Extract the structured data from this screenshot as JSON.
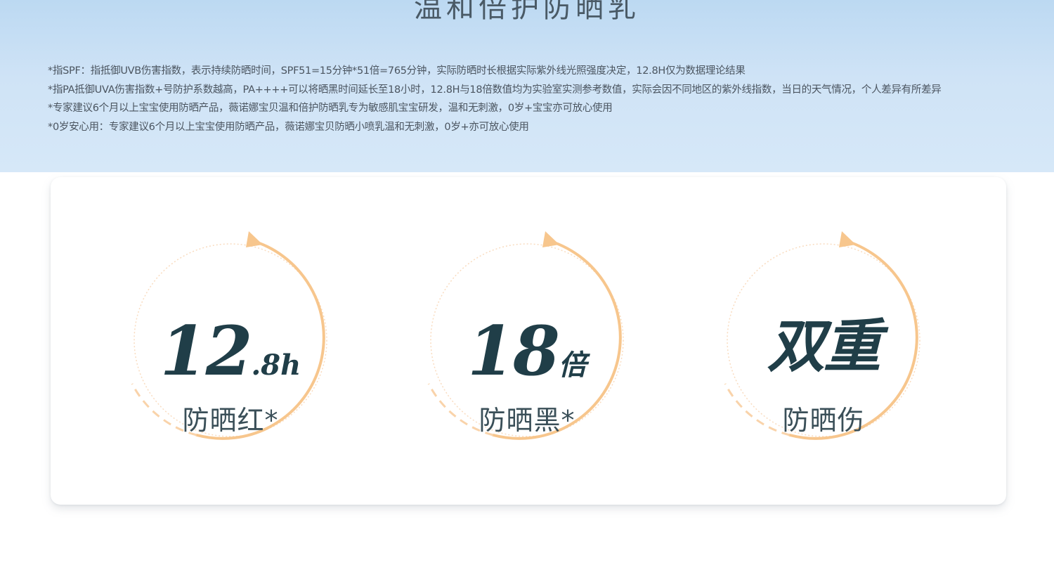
{
  "banner": {
    "title": "温和倍护防晒乳",
    "footnotes": [
      "*指SPF：指抵御UVB伤害指数，表示持续防晒时间，SPF51=15分钟*51倍=765分钟，实际防晒时长根据实际紫外线光照强度决定，12.8H仅为数据理论结果",
      "*指PA抵御UVA伤害指数+号防护系数越高，PA++++可以将晒黑时间延长至18小时，12.8H与18倍数值均为实验室实测参考数值，实际会因不同地区的紫外线指数，当日的天气情况，个人差异有所差异",
      "*专家建议6个月以上宝宝使用防晒产品，薇诺娜宝贝温和倍护防晒乳专为敏感肌宝宝研发，温和无刺激，0岁+宝宝亦可放心使用",
      "*0岁安心用：专家建议6个月以上宝宝使用防晒产品，薇诺娜宝贝防晒小喷乳温和无刺激，0岁+亦可放心使用"
    ]
  },
  "stats": [
    {
      "value_main": "12",
      "value_suffix": ".8h",
      "label": "防晒红*"
    },
    {
      "value_main": "18",
      "value_suffix": "倍",
      "label": "防晒黑*"
    },
    {
      "value_main": "双重",
      "value_suffix": "",
      "label": "防晒伤"
    }
  ],
  "colors": {
    "banner_top": "#bcd9f2",
    "banner_bottom": "#d6e8f8",
    "ring_orange": "#f7c68d",
    "ring_light": "#f9dcc0",
    "value_text": "#203e48",
    "label_text": "#3a4f58"
  }
}
